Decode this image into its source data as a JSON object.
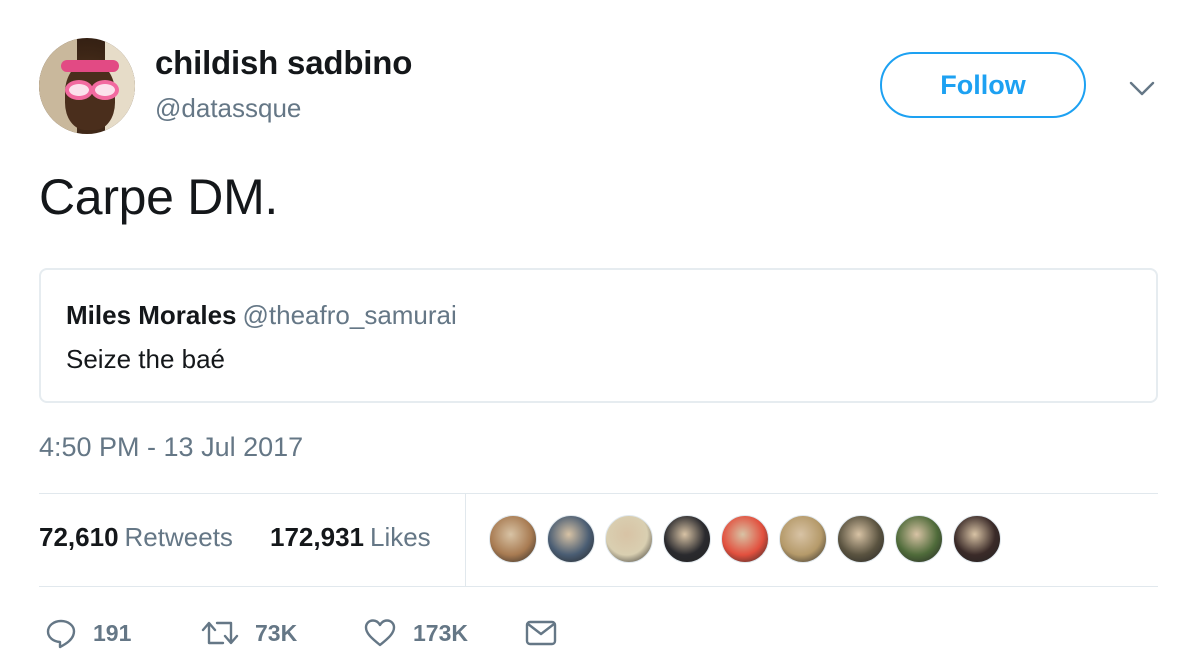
{
  "author": {
    "display_name": "childish sadbino",
    "handle": "@datassque"
  },
  "follow_button": {
    "label": "Follow"
  },
  "tweet": {
    "text": "Carpe DM.",
    "timestamp": "4:50 PM - 13 Jul 2017"
  },
  "quoted_tweet": {
    "name": "Miles Morales",
    "handle": "@theafro_samurai",
    "text": "Seize the baé"
  },
  "stats": {
    "retweets_count": "72,610",
    "retweets_label": "Retweets",
    "likes_count": "172,931",
    "likes_label": "Likes"
  },
  "liker_avatars": [
    {
      "color": "#a87b52"
    },
    {
      "color": "#4a5d73"
    },
    {
      "color": "#d9cfb1"
    },
    {
      "color": "#2a2a2e"
    },
    {
      "color": "#e2503e"
    },
    {
      "color": "#b59a6a"
    },
    {
      "color": "#5a5340"
    },
    {
      "color": "#4f6b3a"
    },
    {
      "color": "#3a2a28"
    }
  ],
  "actions": {
    "reply_count": "191",
    "retweet_count": "73K",
    "like_count": "173K"
  },
  "colors": {
    "accent": "#1da1f2",
    "secondary_text": "#657786",
    "border": "#e1e8ed"
  },
  "icons": {
    "reply": "speech-bubble-icon",
    "retweet": "retweet-arrows-icon",
    "like": "heart-icon",
    "dm": "envelope-icon",
    "menu": "chevron-down-icon"
  }
}
